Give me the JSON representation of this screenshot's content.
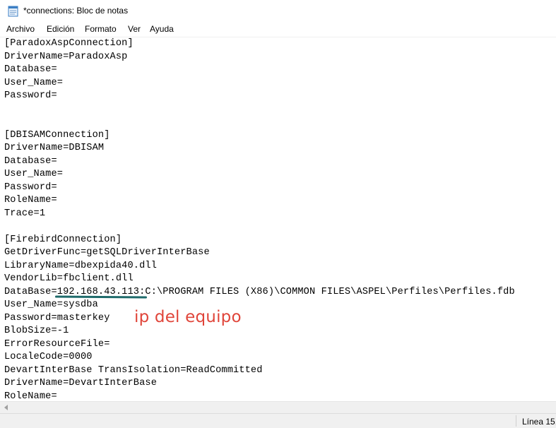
{
  "window": {
    "title": "*connections: Bloc de notas",
    "app_icon": "notepad-icon"
  },
  "menu": {
    "items": [
      "Archivo",
      "Edición",
      "Formato",
      "Ver",
      "Ayuda"
    ]
  },
  "editor": {
    "lines": [
      "[ParadoxAspConnection]",
      "DriverName=ParadoxAsp",
      "Database=",
      "User_Name=",
      "Password=",
      "",
      "",
      "[DBISAMConnection]",
      "DriverName=DBISAM",
      "Database=",
      "User_Name=",
      "Password=",
      "RoleName=",
      "Trace=1",
      "",
      "[FirebirdConnection]",
      "GetDriverFunc=getSQLDriverInterBase",
      "LibraryName=dbexpida40.dll",
      "VendorLib=fbclient.dll",
      "DataBase=192.168.43.113:C:\\PROGRAM FILES (X86)\\COMMON FILES\\ASPEL\\Perfiles\\Perfiles.fdb",
      "User_Name=sysdba",
      "Password=masterkey",
      "BlobSize=-1",
      "ErrorResourceFile=",
      "LocaleCode=0000",
      "DevartInterBase TransIsolation=ReadCommitted",
      "DriverName=DevartInterBase",
      "RoleName="
    ]
  },
  "annotation": {
    "text": "ip del equipo",
    "color": "#e0453a",
    "underline_color": "#1e6a6a"
  },
  "status": {
    "position": "Línea 15,"
  }
}
